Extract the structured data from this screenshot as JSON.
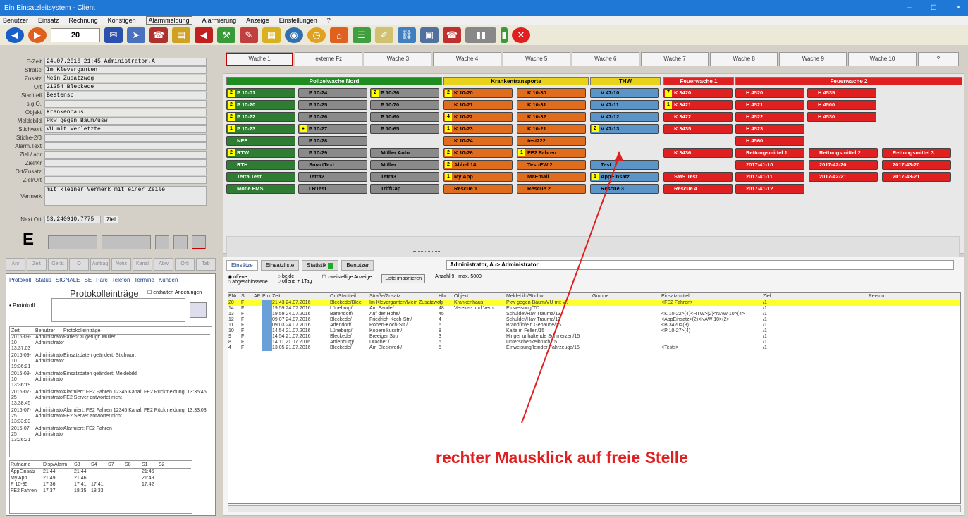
{
  "window": {
    "title": "Ein Einsatzleitsystem - Client",
    "controls": [
      "–",
      "□",
      "×"
    ]
  },
  "menu": [
    "Benutzer",
    "Einsatz",
    "Rechnung",
    "Konstigen",
    "Alarmmeldung",
    "Alarmierung",
    "Anzeige",
    "Einstellungen",
    "?"
  ],
  "menu_active_index": 4,
  "toolbar": {
    "counter": "20",
    "labels": [
      "Sms",
      "Senden",
      "Lautsprecher"
    ]
  },
  "form": {
    "rows": [
      {
        "label": "E-Zeit",
        "value": "24.07.2016    21:45 Administrator,A"
      },
      {
        "label": "Straße",
        "value": "Im Kleverganten"
      },
      {
        "label": "Zusatz",
        "value": "Mein Zusatzweg"
      },
      {
        "label": "Ort",
        "value": "21354  Bleckede"
      },
      {
        "label": "Stadtteil",
        "value": "Bestensp"
      },
      {
        "label": "s.g.O.",
        "value": ""
      },
      {
        "label": "Objekt",
        "value": "Krankenhaus"
      },
      {
        "label": "Meldebild",
        "value": "Pkw gegen Baum/usw"
      },
      {
        "label": "Stichwort",
        "value": "VU mit Verletzte"
      },
      {
        "label": "Stiche-2/3",
        "value": ""
      },
      {
        "label": "Alarm.Text",
        "value": ""
      },
      {
        "label": "Ziel / abr",
        "value": ""
      },
      {
        "label": "Ziel/Kr",
        "value": ""
      },
      {
        "label": "Ort/Zusatz",
        "value": ""
      },
      {
        "label": "Ziel/Ort",
        "value": ""
      },
      {
        "label": "Vermerk",
        "value": "mit kleiner Vermerk mit einer Zeile"
      },
      {
        "label": "Next Ort",
        "value": "53,240910,7775"
      }
    ],
    "big_letter": "E",
    "ziel_button": "Ziel"
  },
  "filter_tabs": [
    "Anr",
    "Zeit",
    "Gerät",
    "O",
    "Auftrag",
    "Notiz",
    "Kanal",
    "Abw",
    "Ortl",
    "Tab"
  ],
  "protokoll": {
    "tabs": [
      "Protokoll",
      "Status",
      "SIGNALE",
      "SE",
      "Parc",
      "Telefon",
      "Termine",
      "Kunden"
    ],
    "title": "Protokolleinträge",
    "checkbox": "enthalten Änderungen",
    "input_label": "• Protokoll",
    "headers": [
      "Zeit",
      "Benutzer",
      "Protokolleinträge"
    ],
    "rows": [
      [
        "2016-09-10 13:37:03",
        "Administrator Administrator",
        "Patient zugefügt: Müller"
      ],
      [
        "2016-09-10 19:36:21",
        "Administrator Administrator",
        "Einsatzdaten geändert: Stichwort"
      ],
      [
        "2016-09-10 13:36:19",
        "Administrator Administrator",
        "Einsatzdaten geändert: Meldebild"
      ],
      [
        "2016-07-25 13:38:45",
        "Administrator Administrator",
        "Alarmiert: FE2 Fahren 12345 Kanal: FE2 Rückmeldung: 13:35:45 FE2 Server antwortet nicht"
      ],
      [
        "2016-07-25 13:33:03",
        "Administrator Administrator",
        "Alarmiert: FE2 Fahren 12345 Kanal: FE2 Rückmeldung: 13:33:03 FE2 Server antwortet nicht"
      ],
      [
        "2016-07-25 13:26:21",
        "Administrator Administrator",
        "Alarmiert: FE2 Fahren"
      ]
    ],
    "stat_headers": [
      "Rufname",
      "Disp/Alarm",
      "S3",
      "S4",
      "S7",
      "S8",
      "S1",
      "S2"
    ],
    "stat_rows": [
      [
        "AppEinsatz",
        "21:44",
        "21:44",
        "",
        "",
        "",
        "21:45",
        ""
      ],
      [
        "My App",
        "21:49",
        "21:46",
        "",
        "",
        "",
        "21:49",
        ""
      ],
      [
        "P 10-35",
        "17:36",
        "17:41",
        "17:41",
        "",
        "",
        "17:42",
        ""
      ],
      [
        "FE2 Fahren",
        "17:37",
        "18:35",
        "18:33",
        "",
        "",
        "",
        ""
      ]
    ]
  },
  "wachen": [
    "Wache 1",
    "externe Fz",
    "Wache 3",
    "Wache 4",
    "Wache 5",
    "Wache 6",
    "Wache 7",
    "Wache 8",
    "Wache 9",
    "Wache 10",
    "?"
  ],
  "groups": [
    {
      "label": "Polizeiwache Nord",
      "color": "#1e8c1e"
    },
    {
      "label": "Krankentransporte",
      "color": "#e8d21a"
    },
    {
      "label": "THW",
      "color": "#e8d21a"
    },
    {
      "label": "Feuerwache 1",
      "color": "#e02020"
    },
    {
      "label": "Feuerwache 2",
      "color": "#e02020"
    }
  ],
  "units": [
    [
      "P 10-01",
      "P 10-24",
      "P 10-36",
      "K 10-20",
      "K 10-30",
      "V 47-10",
      "K 3420",
      "H 4520",
      "H 4535"
    ],
    [
      "P 10-20",
      "P 10-25",
      "P 10-70",
      "K 10-21",
      "K 10-31",
      "V 47-11",
      "K 3421",
      "H 4521",
      "H 4500"
    ],
    [
      "P 10-22",
      "P 10-26",
      "P 10-60",
      "K 10-22",
      "K 10-32",
      "V 47-12",
      "K 3422",
      "H 4522",
      "H 4530"
    ],
    [
      "P 10-23",
      "P 10-27",
      "P 10-65",
      "K 10-23",
      "K 10-21",
      "V 47-13",
      "K 3435",
      "H 4523",
      ""
    ],
    [
      "NEF",
      "P 10-28",
      "",
      "K 10-24",
      "test222",
      "",
      "",
      "H 4560",
      ""
    ],
    [
      "RTW",
      "P 10-29",
      "Müller Auto",
      "K 10-26",
      "FE2 Fahren",
      "",
      "K 3436",
      "Rettungsmittel 1",
      "Rettungsmittel 2",
      "Rettungsmittel 3"
    ],
    [
      "RTH",
      "SmartText",
      "Müller",
      "Abbel 14",
      "Test-EW 2",
      "Test",
      "",
      "2017-41-10",
      "2017-42-20",
      "2017-43-20"
    ],
    [
      "Tetra Test",
      "Tetra2",
      "Tetra3",
      "My App",
      "MaEmail",
      "AppEinsatz",
      "SMS Test",
      "2017-41-11",
      "2017-42-21",
      "2017-43-21"
    ],
    [
      "Motie FMS",
      "LRTest",
      "TriffCap",
      "Rescue 1",
      "Rescue 2",
      "Rescue 3",
      "Rescue 4",
      "2017-41-12",
      "",
      ""
    ]
  ],
  "lower": {
    "tabs": [
      "Einsätze",
      "Einsatzliste",
      "Statistik",
      "Benutzer"
    ],
    "user_box": "Administrator, A -> Administrator",
    "filter_radio": [
      "offene",
      "abgeschlossene"
    ],
    "filter_radio2": [
      "beide",
      "offene + 1Tag"
    ],
    "filter_check": "zweistellige Anzeige",
    "filter_button": "Liste importieren",
    "anzahl_label": "Anzahl",
    "anzahl_val": "9",
    "max_label": "max. 5000",
    "headers": [
      "ENr",
      "St",
      "AP",
      "Pro",
      "Zeit",
      "Ort/Stadtteil",
      "Straße/Zusatz",
      "Hhr",
      "Objekt",
      "Meldebild/Stichw.",
      "Gruppe",
      "Einsatzmittel",
      "Ziel",
      "Person"
    ],
    "rows": [
      [
        "20",
        "F",
        "",
        "",
        "21:43 24.07.2016",
        "Bleckede/Blee",
        "Im Kleverganten/Mein Zusatzweg",
        "4",
        "Krankenhaus",
        "Pkw gegen Baum/VU mit V..",
        "",
        "<FE2 Fahren>",
        "/1",
        ""
      ],
      [
        "14",
        "F",
        "",
        "",
        "19:59 24.07.2016",
        "Lüneburg/",
        "Am Sande/",
        "48",
        "Vereins- und Verb..",
        "Einweisung/TD",
        "",
        "",
        "/1",
        ""
      ],
      [
        "13",
        "F",
        "",
        "",
        "19:59 24.07.2016",
        "Barendorf/",
        "Auf der Höhe/",
        "45",
        "",
        "Schuldet/Hav Trauma/13",
        "",
        "<K 10-22>(4)<RTW>(2)<NAW 10>(4>",
        "/1",
        ""
      ],
      [
        "12",
        "F",
        "",
        "",
        "09:07 24.07.2016",
        "Bleckede/",
        "Friedrich-Koch-Str./",
        "4",
        "",
        "Schuldet/Hav Trauma/13",
        "",
        "<AppEinsatz>(2)<NAW 10>(2>",
        "/1",
        ""
      ],
      [
        "11",
        "F",
        "",
        "",
        "09:03 24.07.2016",
        "Adendorf/",
        "Robert-Koch-Str./",
        "6",
        "",
        "Brand/in/ein Gebäude/15",
        "",
        "<B 3420>(3)",
        "/1",
        ""
      ],
      [
        "10",
        "F",
        "",
        "",
        "14:54 21.07.2016",
        "Lüneburg/",
        "Kopernikusstr./",
        "8",
        "",
        "Kalte in Fellen/15",
        "",
        "<P 10-27>(4)",
        "/1",
        ""
      ],
      [
        "9",
        "F",
        "",
        "",
        "14:54 21.07.2016",
        "Bleckede/",
        "Breeiger Str./",
        "3",
        "",
        "Hinger unhaltende Schmerzen/15",
        "",
        "",
        "/1",
        ""
      ],
      [
        "8",
        "F",
        "",
        "",
        "14:11 21.07.2016",
        "Artlenburg/",
        "Drachet./",
        "5",
        "",
        "Unterschenkelbruch/15",
        "",
        "",
        "/1",
        ""
      ],
      [
        "4",
        "F",
        "",
        "",
        "13:05 21.07.2016",
        "Bleckede/",
        "Am Bleckwerk/",
        "5",
        "",
        "Einweisung/leinder Fahrzeuge/15",
        "",
        "<Tests>",
        "/1",
        ""
      ]
    ]
  },
  "annotation": "rechter Mausklick auf freie Stelle"
}
